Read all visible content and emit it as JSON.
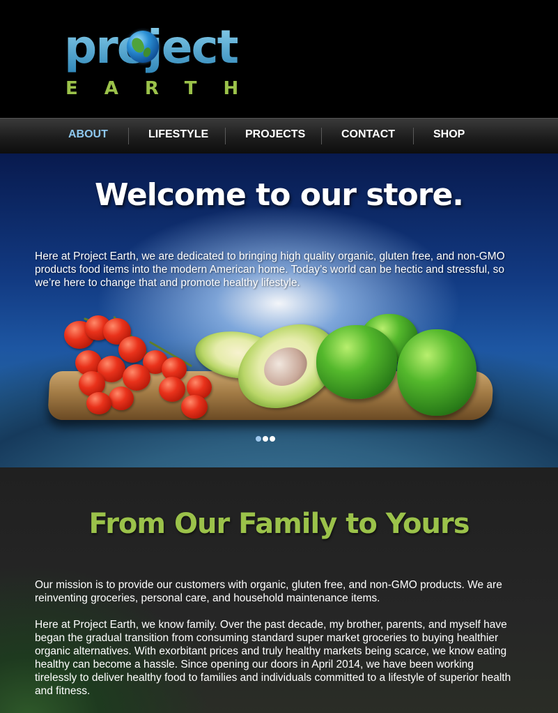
{
  "logo": {
    "word": "project",
    "sub": "EARTH"
  },
  "nav": {
    "items": [
      {
        "label": "ABOUT"
      },
      {
        "label": "LIFESTYLE"
      },
      {
        "label": "PROJECTS"
      },
      {
        "label": "CONTACT"
      },
      {
        "label": "SHOP"
      }
    ],
    "active": "ABOUT"
  },
  "hero": {
    "title": "Welcome to our store.",
    "text": "Here at Project Earth, we are dedicated to bringing high quality organic, gluten free, and non-GMO products food items into the modern American home. Today’s world can be hectic and stressful, so we’re here to change that and promote healthy lifestyle.",
    "slides": 3,
    "active_slide": 1
  },
  "mission": {
    "title": "From Our Family to Yours",
    "paragraph1": "Our mission is to provide our customers with organic, gluten free, and non-GMO products. We are reinventing groceries, personal care, and household maintenance items.",
    "paragraph2": "Here at Project Earth, we know family. Over the past decade, my brother, parents, and myself have began the gradual transition from consuming standard super market groceries to buying healthier organic alternatives. With exorbitant prices and truly healthy markets being scarce, we know eating healthy can become a hassle. Since opening our doors in April 2014, we have been working tirelessly to deliver healthy food to families and individuals committed to a lifestyle of superior health and fitness."
  },
  "colors": {
    "brand_blue": "#4ea7cf",
    "brand_green": "#9bc24a",
    "nav_active": "#8ec8ef"
  }
}
